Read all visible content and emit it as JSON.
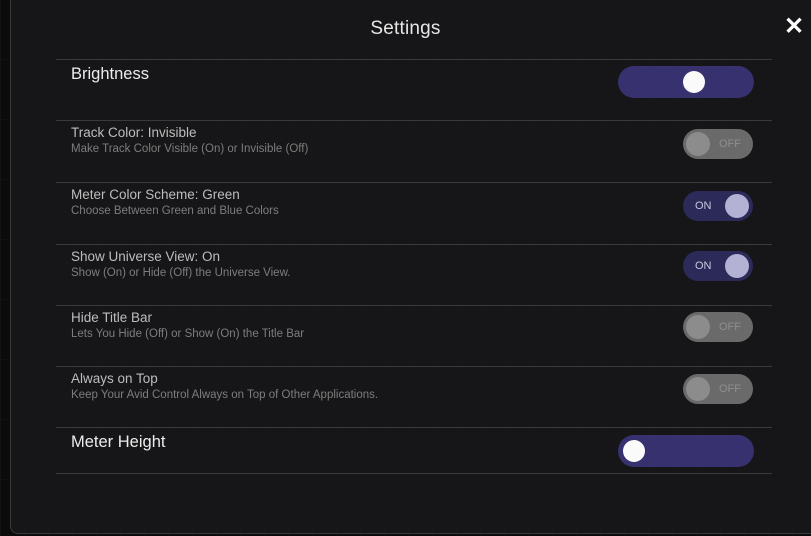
{
  "header": {
    "title": "Settings",
    "close_symbol": "✕"
  },
  "brightness": {
    "label": "Brightness",
    "value_fraction": 0.58
  },
  "toggles": [
    {
      "title": "Track Color: Invisible",
      "description": "Make Track Color Visible (On) or Invisible (Off)",
      "state": "OFF"
    },
    {
      "title": "Meter Color Scheme: Green",
      "description": "Choose Between Green and Blue Colors",
      "state": "ON"
    },
    {
      "title": "Show Universe View: On",
      "description": "Show (On) or Hide (Off) the Universe View.",
      "state": "ON"
    },
    {
      "title": "Hide Title Bar",
      "description": "Lets You Hide (Off) or Show (On) the Title Bar",
      "state": "OFF"
    },
    {
      "title": "Always on Top",
      "description": "Keep Your Avid Control Always on Top of Other Applications.",
      "state": "OFF"
    }
  ],
  "meter_height": {
    "label": "Meter Height",
    "value_fraction": 0.0
  },
  "colors": {
    "slider_track": "#373170",
    "toggle_on": "#2c2a58",
    "toggle_off": "#6a6a6a"
  }
}
